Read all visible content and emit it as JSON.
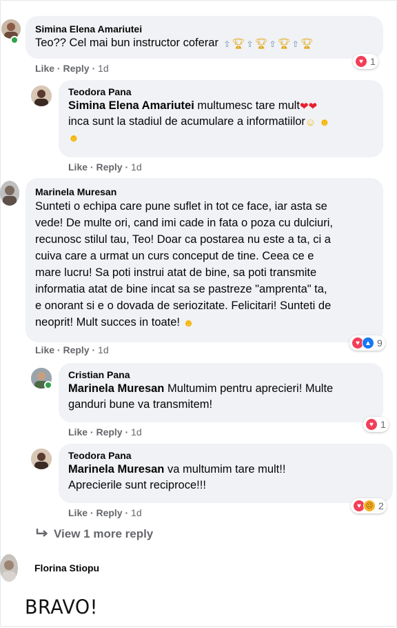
{
  "comments": [
    {
      "author": "Simina Elena Amariutei",
      "text": "Teo?? Cel mai bun instructor coferar",
      "like": "Like",
      "reply": "Reply",
      "time": "1d",
      "reaction_count": "1"
    },
    {
      "author": "Teodora Pana",
      "mention": "Simina Elena Amariutei",
      "text_a": "multumesc tare mult",
      "text_b": "inca sunt la stadiul de acumulare a informatiilor",
      "like": "Like",
      "reply": "Reply",
      "time": "1d"
    },
    {
      "author": "Marinela Muresan",
      "lines": [
        "Sunteti o echipa care pune suflet in tot ce face, iar asta se",
        "vede! De multe ori, cand imi cade in fata o poza cu dulciuri,",
        "recunosc stilul tau, Teo! Doar ca postarea nu este a ta, ci a",
        "cuiva care a urmat un curs conceput de tine. Ceea ce e",
        "mare lucru! Sa poti instrui atat de bine, sa poti transmite",
        "informatia atat de bine incat sa se pastreze \"amprenta\" ta,",
        "e onorant si e o dovada de seriozitate. Felicitari! Sunteti de",
        "neoprit! Mult succes in toate!"
      ],
      "like": "Like",
      "reply": "Reply",
      "time": "1d",
      "reaction_count": "9"
    },
    {
      "author": "Cristian Pana",
      "mention": "Marinela Muresan",
      "text_a": "Multumim pentru aprecieri! Multe",
      "text_b": "ganduri bune va transmitem!",
      "like": "Like",
      "reply": "Reply",
      "time": "1d",
      "reaction_count": "1"
    },
    {
      "author": "Teodora Pana",
      "mention": "Marinela Muresan",
      "text_a": "va multumim tare mult!!",
      "text_b": "Aprecierile sunt reciproce!!!",
      "like": "Like",
      "reply": "Reply",
      "time": "1d",
      "reaction_count": "2"
    }
  ],
  "view_more": "View 1 more reply",
  "last_comment": {
    "author": "Florina Stiopu",
    "handwritten": "BRAVO!"
  },
  "separator": "·",
  "icons": {
    "reaction_love": "heart-reaction-icon",
    "reaction_like": "thumbs-up-reaction-icon",
    "reaction_sad": "sad-reaction-icon",
    "reply_arrow": "reply-arrow-icon"
  },
  "colors": {
    "bubble": "#f0f2f5",
    "muted": "#65676b",
    "love": "#f33e58",
    "like": "#1877f2",
    "online": "#31a24c"
  }
}
